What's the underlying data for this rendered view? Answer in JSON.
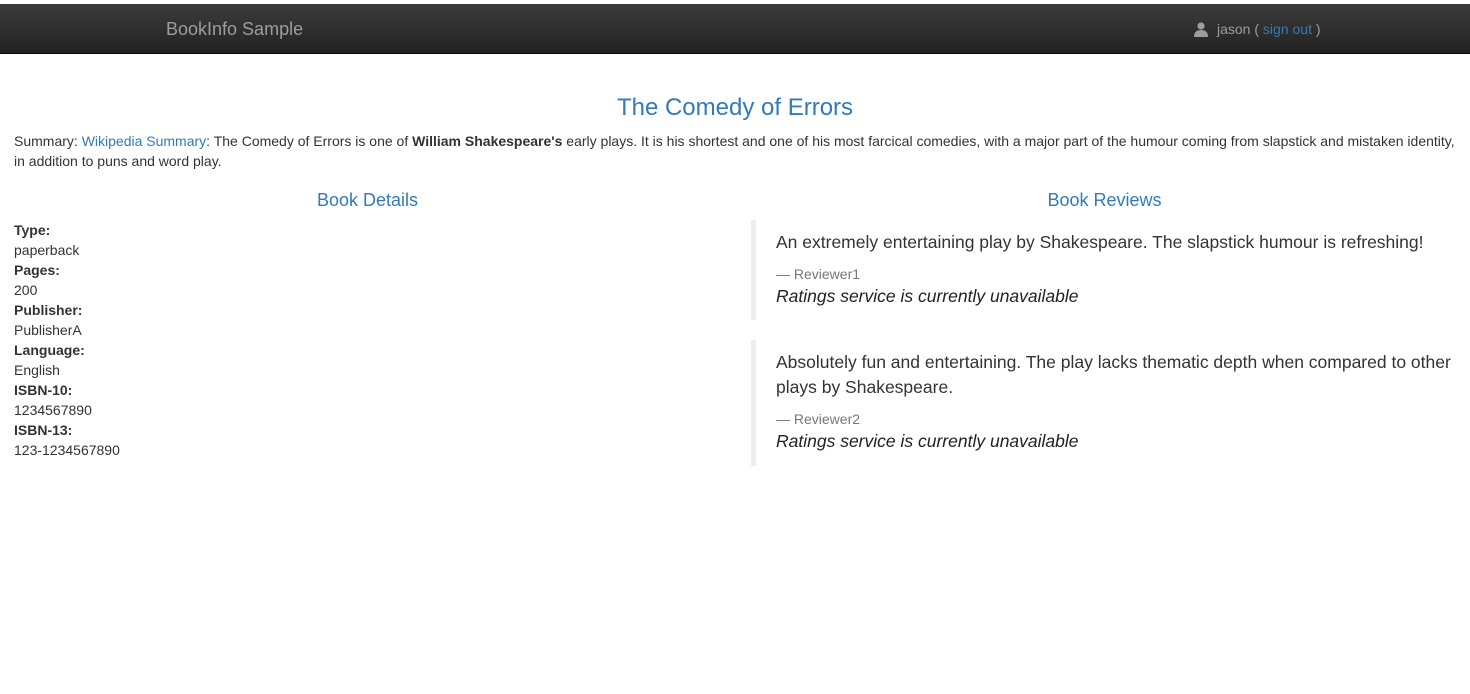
{
  "navbar": {
    "brand": "BookInfo Sample",
    "user_icon": "user-icon",
    "username": "jason",
    "open_paren": "(",
    "sign_out": "sign out",
    "close_paren": ")"
  },
  "book": {
    "title": "The Comedy of Errors",
    "summary_prefix": "Summary:",
    "summary_link": "Wikipedia Summary",
    "summary_text_1": ": The Comedy of Errors is one of ",
    "summary_bold": "William Shakespeare's",
    "summary_text_2": " early plays. It is his shortest and one of his most farcical comedies, with a major part of the humour coming from slapstick and mistaken identity, in addition to puns and word play."
  },
  "details": {
    "heading": "Book Details",
    "items": [
      {
        "label": "Type:",
        "value": "paperback"
      },
      {
        "label": "Pages:",
        "value": "200"
      },
      {
        "label": "Publisher:",
        "value": "PublisherA"
      },
      {
        "label": "Language:",
        "value": "English"
      },
      {
        "label": "ISBN-10:",
        "value": "1234567890"
      },
      {
        "label": "ISBN-13:",
        "value": "123-1234567890"
      }
    ]
  },
  "reviews": {
    "heading": "Book Reviews",
    "items": [
      {
        "text": "An extremely entertaining play by Shakespeare. The slapstick humour is refreshing!",
        "reviewer": "— Reviewer1",
        "rating": "Ratings service is currently unavailable"
      },
      {
        "text": "Absolutely fun and entertaining. The play lacks thematic depth when compared to other plays by Shakespeare.",
        "reviewer": "— Reviewer2",
        "rating": "Ratings service is currently unavailable"
      }
    ]
  },
  "colors": {
    "navbar_bg": "#222222",
    "link": "#337ab7",
    "text": "#333333",
    "muted": "#777777"
  }
}
